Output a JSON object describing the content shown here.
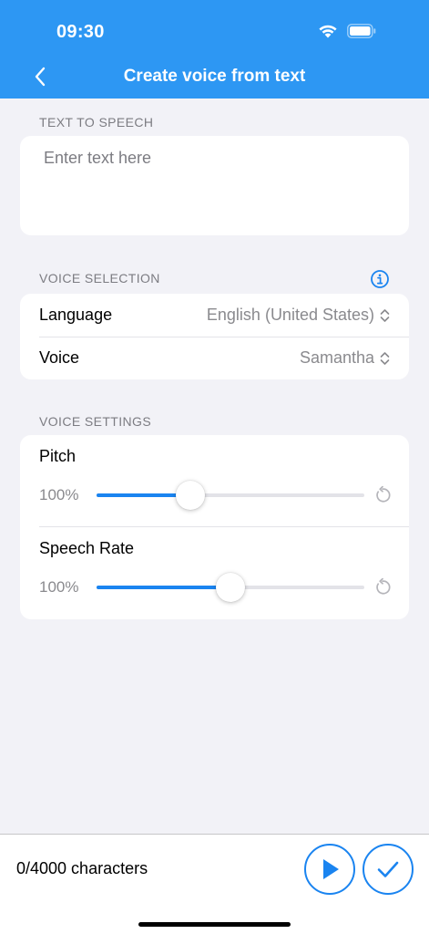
{
  "status_bar": {
    "time": "09:30"
  },
  "nav": {
    "title": "Create voice from text"
  },
  "text_to_speech": {
    "section_label": "TEXT TO SPEECH",
    "placeholder": "Enter text here",
    "value": ""
  },
  "voice_selection": {
    "section_label": "VOICE SELECTION",
    "language_label": "Language",
    "language_value": "English (United States)",
    "voice_label": "Voice",
    "voice_value": "Samantha"
  },
  "voice_settings": {
    "section_label": "VOICE SETTINGS",
    "pitch_label": "Pitch",
    "pitch_value": "100%",
    "pitch_slider_fraction": 0.35,
    "rate_label": "Speech Rate",
    "rate_value": "100%",
    "rate_slider_fraction": 0.5
  },
  "footer": {
    "char_count": "0/4000 characters"
  },
  "colors": {
    "accent": "#2d97f3",
    "slider": "#1a84f0",
    "background": "#f2f2f7"
  }
}
